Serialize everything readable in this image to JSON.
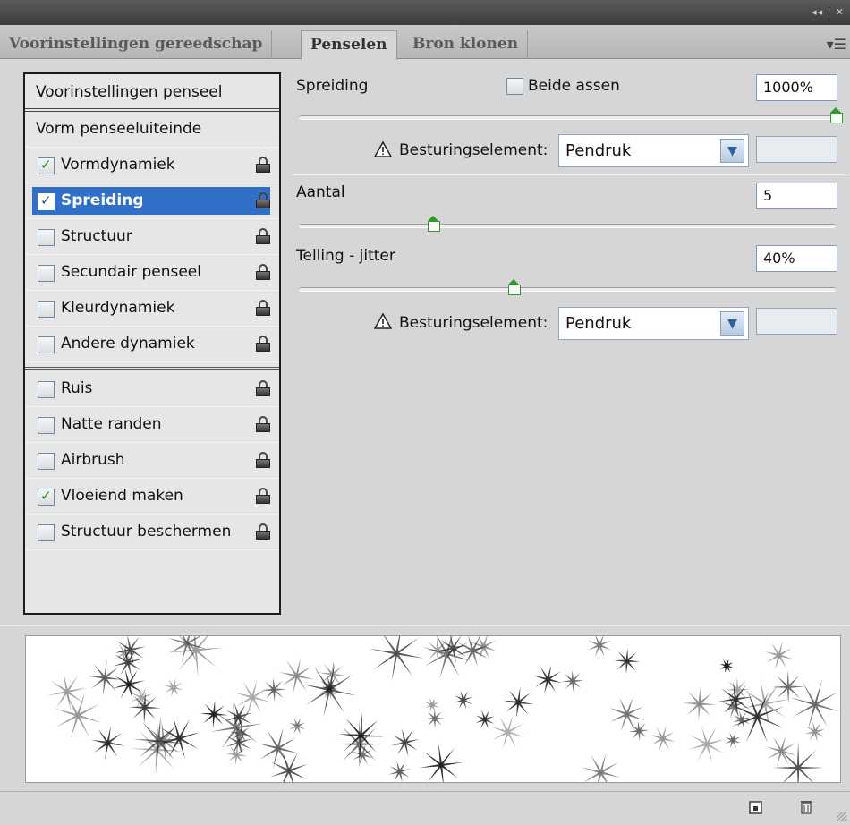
{
  "tabs": [
    {
      "label": "Voorinstellingen gereedschap",
      "active": false
    },
    {
      "label": "Penselen",
      "active": true
    },
    {
      "label": "Bron klonen",
      "active": false
    }
  ],
  "left_panel": {
    "header": "Voorinstellingen penseel",
    "plain_item": "Vorm penseeluiteinde",
    "items_group1": [
      {
        "label": "Vormdynamiek",
        "checked": true,
        "selected": false
      },
      {
        "label": "Spreiding",
        "checked": true,
        "selected": true
      },
      {
        "label": "Structuur",
        "checked": false,
        "selected": false
      },
      {
        "label": "Secundair penseel",
        "checked": false,
        "selected": false
      },
      {
        "label": "Kleurdynamiek",
        "checked": false,
        "selected": false
      },
      {
        "label": "Andere dynamiek",
        "checked": false,
        "selected": false
      }
    ],
    "items_group2": [
      {
        "label": "Ruis",
        "checked": false
      },
      {
        "label": "Natte randen",
        "checked": false
      },
      {
        "label": "Airbrush",
        "checked": false
      },
      {
        "label": "Vloeiend maken",
        "checked": true
      },
      {
        "label": "Structuur beschermen",
        "checked": false
      }
    ]
  },
  "scatter": {
    "label": "Spreiding",
    "both_axes_label": "Beide assen",
    "both_axes_checked": false,
    "value": "1000%",
    "slider_fraction": 1.0,
    "control_label": "Besturingselement:",
    "control_value": "Pendruk"
  },
  "count": {
    "label": "Aantal",
    "value": "5",
    "slider_fraction": 0.25
  },
  "count_jitter": {
    "label": "Telling - jitter",
    "value": "40%",
    "slider_fraction": 0.4,
    "control_label": "Besturingselement:",
    "control_value": "Pendruk"
  },
  "colors": {
    "selection": "#3170c8",
    "slider_thumb": "#2e9a2e",
    "checkmark": "#1f8a1f"
  }
}
